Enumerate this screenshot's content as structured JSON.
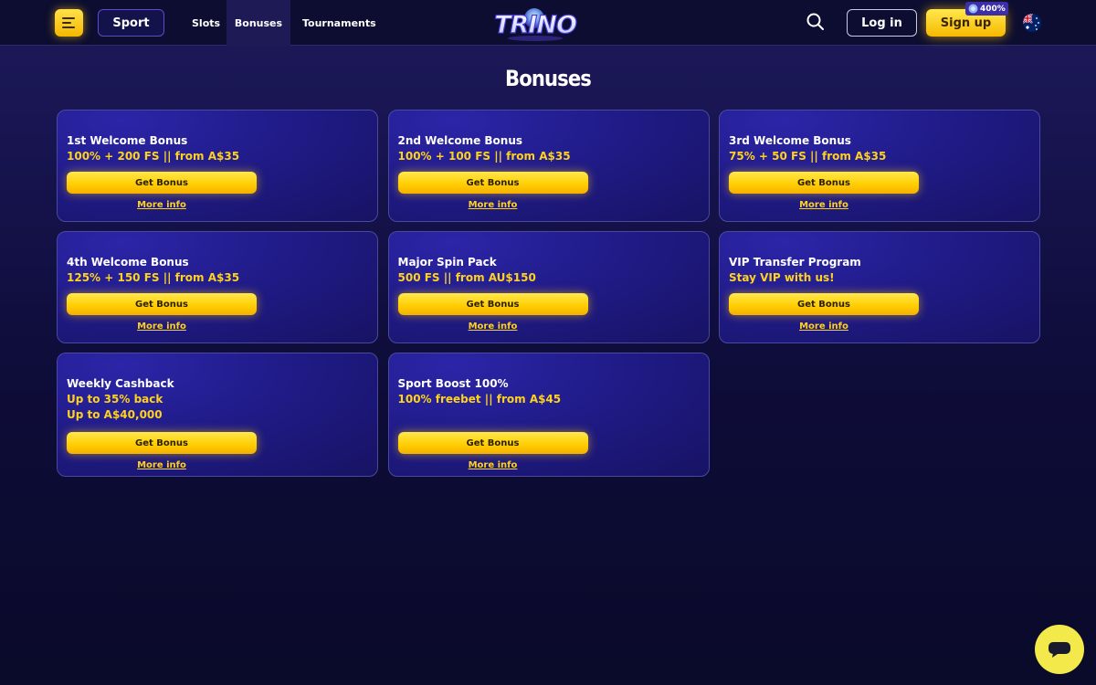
{
  "header": {
    "menu_icon": "menu-icon",
    "sport_label": "Sport",
    "nav": [
      {
        "label": "Slots",
        "active": false
      },
      {
        "label": "Bonuses",
        "active": true
      },
      {
        "label": "Tournaments",
        "active": false
      }
    ],
    "logo_text": "TRINO",
    "search_icon": "search-icon",
    "login_label": "Log in",
    "signup_label": "Sign up",
    "promo_badge": "400%",
    "flag_icon": "australia-flag-icon"
  },
  "page": {
    "title": "Bonuses"
  },
  "bonuses": [
    {
      "title": "1st Welcome Bonus",
      "lines": [
        "100% + 200 FS || from A$35"
      ],
      "button": "Get Bonus",
      "link": "More info"
    },
    {
      "title": "2nd Welcome Bonus",
      "lines": [
        "100% + 100 FS || from A$35"
      ],
      "button": "Get Bonus",
      "link": "More info"
    },
    {
      "title": "3rd Welcome Bonus",
      "lines": [
        "75% + 50 FS || from A$35"
      ],
      "button": "Get Bonus",
      "link": "More info"
    },
    {
      "title": "4th Welcome Bonus",
      "lines": [
        "125% + 150 FS || from A$35"
      ],
      "button": "Get Bonus",
      "link": "More info"
    },
    {
      "title": "Major Spin Pack",
      "lines": [
        "500 FS || from AU$150"
      ],
      "button": "Get Bonus",
      "link": "More info"
    },
    {
      "title": "VIP Transfer Program",
      "lines": [
        "Stay VIP with us!"
      ],
      "button": "Get Bonus",
      "link": "More info"
    },
    {
      "title": "Weekly Cashback",
      "lines": [
        "Up to 35% back",
        "Up to A$40,000"
      ],
      "button": "Get Bonus",
      "link": "More info"
    },
    {
      "title": "Sport Boost 100%",
      "lines": [
        "100% freebet || from A$45"
      ],
      "button": "Get Bonus",
      "link": "More info"
    }
  ],
  "chat": {
    "icon": "chat-icon"
  },
  "colors": {
    "accent": "#ffd21e",
    "background": "#0e0c38",
    "card": "#201b88"
  }
}
